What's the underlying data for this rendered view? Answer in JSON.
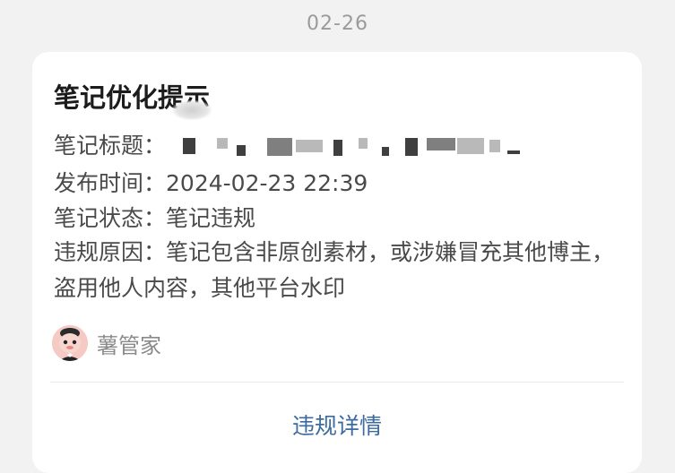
{
  "date": "02-26",
  "card": {
    "title": "笔记优化提示",
    "fields": {
      "title_label": "笔记标题：",
      "publish_label": "发布时间：",
      "publish_value": "2024-02-23 22:39",
      "status_label": "笔记状态：",
      "status_value": "笔记违规",
      "reason_label": "违规原因：",
      "reason_value": "笔记包含非原创素材，或涉嫌冒充其他博主，盗用他人内容，其他平台水印"
    },
    "author": {
      "name": "薯管家",
      "avatar_icon": "butler-avatar-icon"
    },
    "action_label": "违规详情",
    "colors": {
      "action": "#3d6a9f",
      "text": "#4a4a4a",
      "muted": "#8a8a8a"
    }
  }
}
